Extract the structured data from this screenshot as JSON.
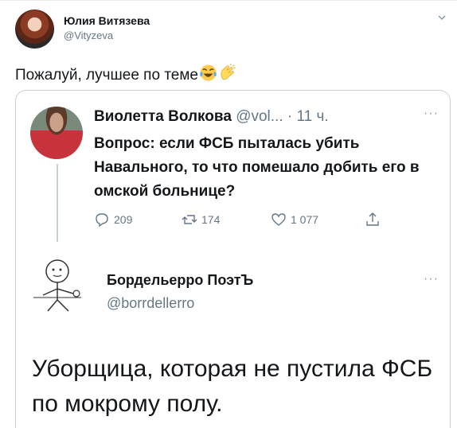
{
  "tweet": {
    "author_name": "Юлия Витязева",
    "author_handle": "@Vityzeva",
    "text": "Пожалуй, лучшее по теме",
    "emojis": [
      "laughing-crying-emoji",
      "clapping-hands-emoji"
    ]
  },
  "quoted": {
    "name": "Виолетта Волкова",
    "handle": "@vol...",
    "time": "· 11 ч.",
    "more": "···",
    "text": "Вопрос:  если ФСБ пыталась убить Навального, то что помешало добить его в омской больнице?",
    "replies": "209",
    "retweets": "174",
    "likes": "1 077"
  },
  "reply": {
    "name": "Бордельерро ПоэтЪ",
    "handle": "@borrdellerro",
    "more": "···",
    "text": "Уборщица, которая не пустила ФСБ по мокрому полу."
  },
  "colors": {
    "text": "#14171a",
    "secondary": "#657786",
    "border": "#c9d2d9"
  }
}
